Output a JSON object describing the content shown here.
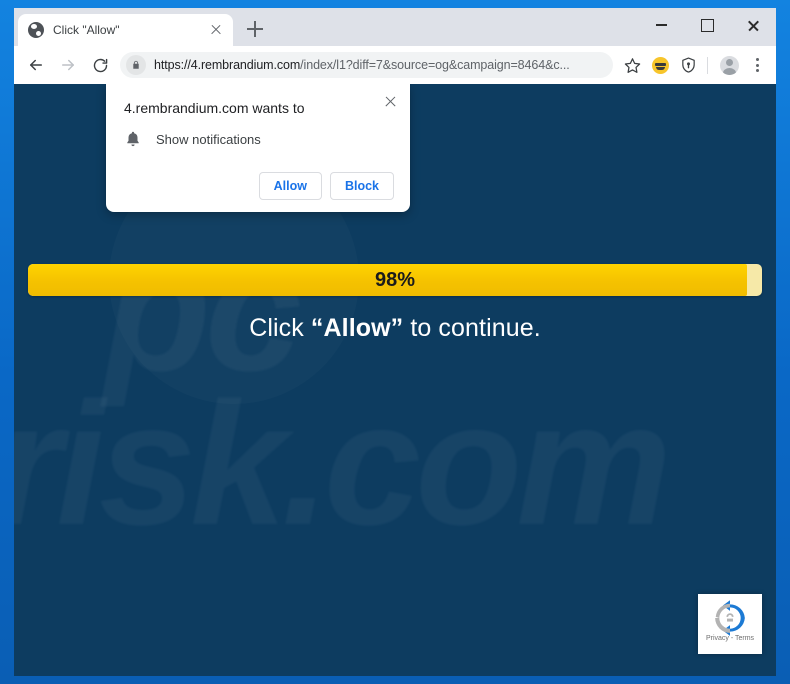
{
  "window": {
    "controls": {
      "minimize": "Minimize",
      "maximize": "Maximize",
      "close": "Close"
    }
  },
  "tabstrip": {
    "tabs": [
      {
        "title": "Click \"Allow\"",
        "favicon": "globe-icon",
        "close_label": "Close tab"
      }
    ],
    "new_tab_label": "New tab"
  },
  "toolbar": {
    "back_label": "Back",
    "forward_label": "Forward",
    "reload_label": "Reload",
    "lock_icon": "lock-icon",
    "url_scheme": "https://",
    "url_host": "4.rembrandium.com",
    "url_path": "/index/l1?diff=7&source=og&campaign=8464&c...",
    "url_full": "https://4.rembrandium.com/index/l1?diff=7&source=og&campaign=8464&c...",
    "bookmark_label": "Bookmark this tab",
    "extension_smiley_label": "Extension",
    "extension_shield_label": "Shield extension",
    "profile_label": "Profile",
    "menu_label": "Customize and control Google Chrome"
  },
  "permission_dialog": {
    "title": "4.rembrandium.com wants to",
    "permission_icon": "bell-icon",
    "permission_label": "Show notifications",
    "allow_label": "Allow",
    "block_label": "Block",
    "close_label": "Close"
  },
  "page": {
    "background_color": "#0d3c60",
    "watermark_line1": "pc",
    "watermark_line2": "risk.com",
    "progress": {
      "percent_label": "98%",
      "percent_value": 98,
      "fill_color": "#f5c200",
      "track_color": "#f6e9a8"
    },
    "headline_prefix": "Click ",
    "headline_emphasis": "“Allow”",
    "headline_suffix": " to continue.",
    "recaptcha": {
      "logo": "recaptcha-icon",
      "text": "Privacy - Terms"
    }
  },
  "colors": {
    "frame_blue": "#0b6ecd",
    "page_navy": "#0d3c60",
    "accent_yellow": "#f5c200",
    "link_blue": "#1a73e8"
  }
}
